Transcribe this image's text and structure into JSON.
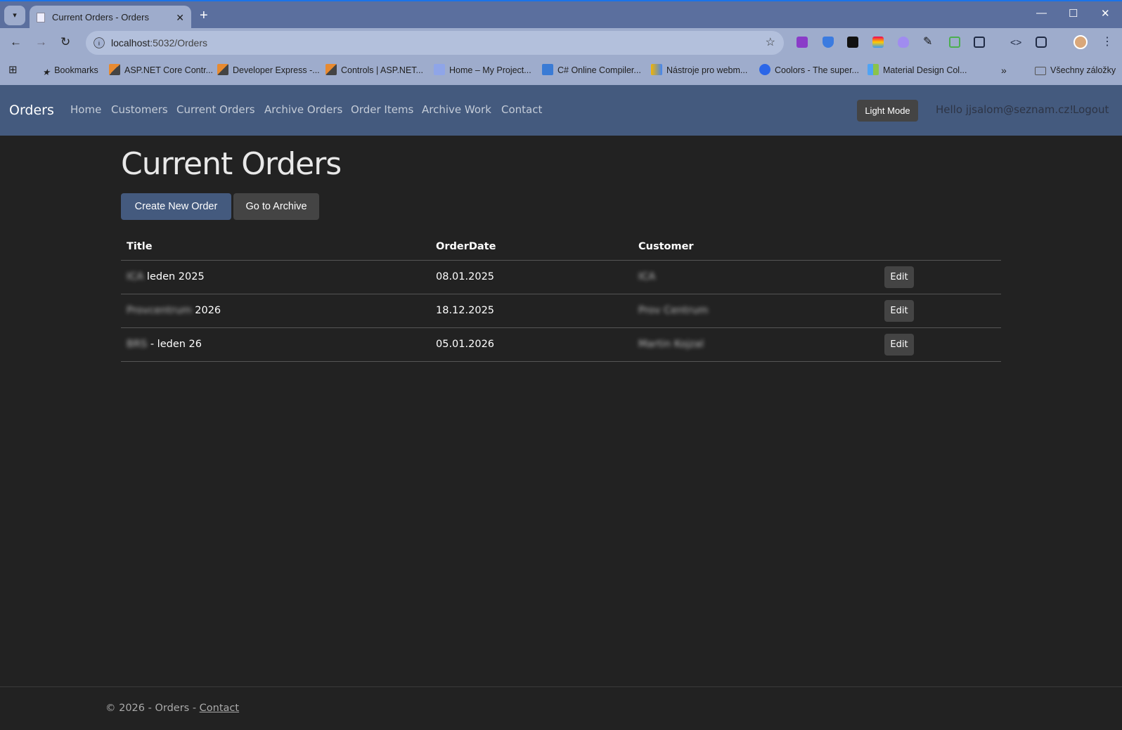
{
  "browser": {
    "tab_title": "Current Orders - Orders",
    "url_host": "localhost",
    "url_rest": ":5032/Orders",
    "bookmarks": [
      "Bookmarks",
      "ASP.NET Core Contr...",
      "Developer Express -...",
      "Controls | ASP.NET...",
      "Home – My Project...",
      "C# Online Compiler...",
      "Nástroje pro webm...",
      "Coolors - The super...",
      "Material Design Col..."
    ],
    "all_bookmarks": "Všechny záložky"
  },
  "navbar": {
    "brand": "Orders",
    "links": [
      "Home",
      "Customers",
      "Current Orders",
      "Archive Orders",
      "Order Items",
      "Archive Work",
      "Contact"
    ],
    "light_mode": "Light Mode",
    "hello": "Hello jjsalom@seznam.cz!",
    "logout": "Logout"
  },
  "page": {
    "title": "Current Orders",
    "create_button": "Create New Order",
    "archive_button": "Go to Archive"
  },
  "table": {
    "headers": [
      "Title",
      "OrderDate",
      "Customer"
    ],
    "rows": [
      {
        "title_blurred": "ICA",
        "title": " leden 2025",
        "date": "08.01.2025",
        "customer": "ICA",
        "edit": "Edit"
      },
      {
        "title_blurred": "Provcentrum",
        "title": " 2026",
        "date": "18.12.2025",
        "customer": "Prov Centrum",
        "edit": "Edit"
      },
      {
        "title_blurred": "BRS",
        "title": " - leden 26",
        "date": "05.01.2026",
        "customer": "Martin Kojzal",
        "edit": "Edit"
      }
    ]
  },
  "footer": {
    "text": "© 2026 - Orders - ",
    "link": "Contact"
  },
  "colors": {
    "navbar": "#445a7e",
    "primary_button": "#445a7e",
    "secondary_button": "#444444",
    "background": "#222222"
  }
}
